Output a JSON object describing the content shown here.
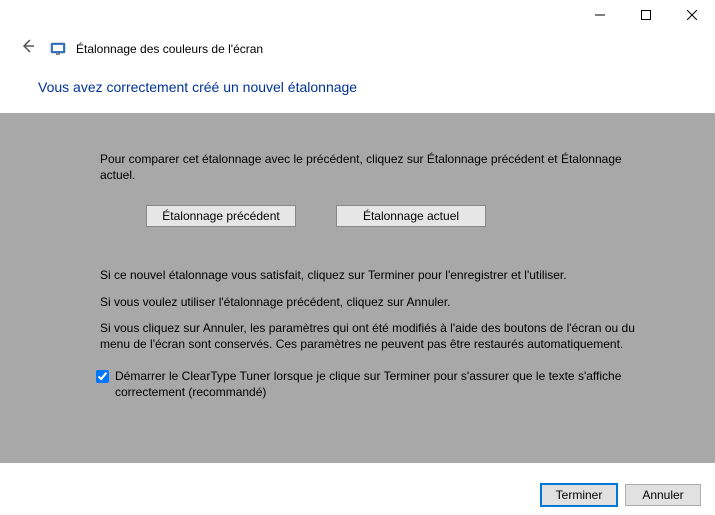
{
  "window": {
    "title": "Étalonnage des couleurs de l'écran"
  },
  "main": {
    "heading": "Vous avez correctement créé un nouvel étalonnage",
    "compare_text": "Pour comparer cet étalonnage avec le précédent, cliquez sur Étalonnage précédent et Étalonnage actuel.",
    "btn_previous": "Étalonnage précédent",
    "btn_current": "Étalonnage actuel",
    "para_satisf": "Si ce nouvel étalonnage vous satisfait, cliquez sur Terminer pour l'enregistrer et l'utiliser.",
    "para_cancel": "Si vous voulez utiliser l'étalonnage précédent, cliquez sur Annuler.",
    "para_warn": "Si vous cliquez sur Annuler, les paramètres qui ont été modifiés à l'aide des boutons de l'écran ou du menu de l'écran sont conservés. Ces paramètres ne peuvent pas être restaurés automatiquement.",
    "checkbox_label": "Démarrer le ClearType Tuner lorsque je clique sur Terminer pour s'assurer que le texte s'affiche correctement (recommandé)"
  },
  "footer": {
    "finish": "Terminer",
    "cancel": "Annuler"
  }
}
